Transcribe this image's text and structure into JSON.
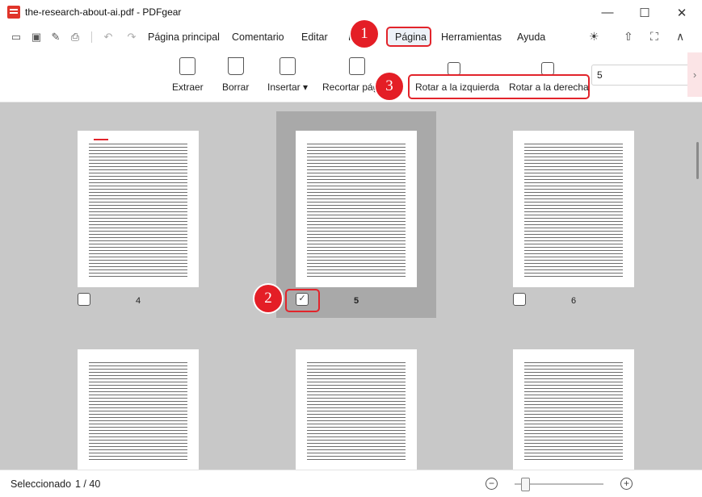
{
  "window": {
    "title": "the-research-about-ai.pdf - PDFgear",
    "minimize": "—",
    "maximize": "☐",
    "close": "✕"
  },
  "menu": {
    "items": [
      "Página principal",
      "Comentario",
      "Editar",
      "F",
      "Página",
      "Herramientas",
      "Ayuda"
    ],
    "active": "Página",
    "theme_icon": "☀",
    "share_icon": "⇧",
    "fullscreen_icon": "⛶",
    "collapse_icon": "∧"
  },
  "ribbon": {
    "extract": "Extraer",
    "delete": "Borrar",
    "insert": "Insertar ▾",
    "crop": "Recortar pág",
    "rotate_left": "Rotar a la izquierda",
    "rotate_right": "Rotar a la derecha",
    "page_input": "5",
    "scroll_arrow": "›"
  },
  "thumbnails": [
    {
      "page": "4",
      "checked": false
    },
    {
      "page": "5",
      "checked": true
    },
    {
      "page": "6",
      "checked": false
    }
  ],
  "badges": [
    "1",
    "2",
    "3"
  ],
  "status": {
    "selected_label": "Seleccionado",
    "count": "1  /  40",
    "zoom_out": "−",
    "zoom_in": "+"
  },
  "colors": {
    "annotation_red": "#e2242b",
    "badge_red": "#e41e26",
    "background": "#c8c8c8"
  }
}
